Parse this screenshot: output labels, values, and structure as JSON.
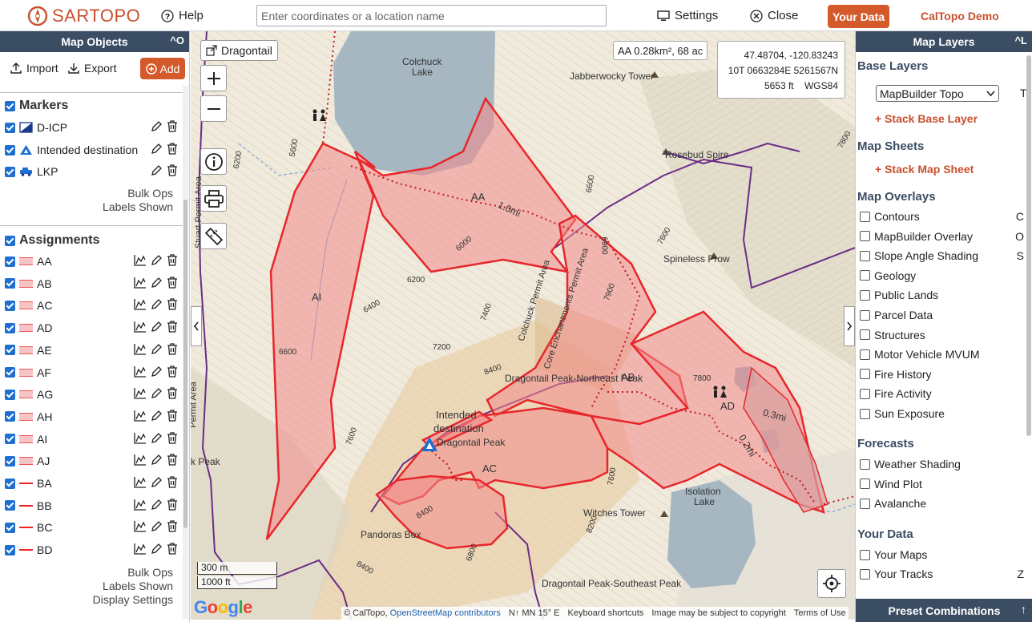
{
  "topbar": {
    "logo_a": "SAR",
    "logo_b": "TOPO",
    "help": "Help",
    "search_placeholder": "Enter coordinates or a location name",
    "settings": "Settings",
    "close": "Close",
    "your_data": "Your Data",
    "demo": "CalTopo Demo"
  },
  "left_panel": {
    "title": "Map Objects",
    "collapse_ctl": "^O",
    "import": "Import",
    "export": "Export",
    "add": "Add",
    "markers_title": "Markers",
    "markers": [
      {
        "label": "D-ICP"
      },
      {
        "label": "Intended destination"
      },
      {
        "label": "LKP"
      }
    ],
    "markers_bulk": "Bulk Ops",
    "markers_labels": "Labels Shown",
    "assignments_title": "Assignments",
    "assignments": [
      {
        "label": "AA",
        "kind": "area"
      },
      {
        "label": "AB",
        "kind": "area"
      },
      {
        "label": "AC",
        "kind": "area"
      },
      {
        "label": "AD",
        "kind": "area"
      },
      {
        "label": "AE",
        "kind": "area"
      },
      {
        "label": "AF",
        "kind": "area"
      },
      {
        "label": "AG",
        "kind": "area"
      },
      {
        "label": "AH",
        "kind": "area"
      },
      {
        "label": "AI",
        "kind": "area"
      },
      {
        "label": "AJ",
        "kind": "area"
      },
      {
        "label": "BA",
        "kind": "line"
      },
      {
        "label": "BB",
        "kind": "line"
      },
      {
        "label": "BC",
        "kind": "line"
      },
      {
        "label": "BD",
        "kind": "line"
      }
    ],
    "assign_bulk": "Bulk Ops",
    "assign_labels": "Labels Shown",
    "assign_display": "Display Settings"
  },
  "map": {
    "sheet_button": "Dragontail",
    "area_readout": "AA 0.28km², 68 ac",
    "coords": {
      "latlon": "47.48704, -120.83243",
      "utm": "10T 0663284E 5261567N",
      "elev": "5653 ft",
      "datum": "WGS84"
    },
    "scale_m": "300 m",
    "scale_ft": "1000 ft",
    "google": "Google",
    "attrib_caltopo": "© CalTopo,",
    "attrib_osm": "OpenStreetMap contributors",
    "attrib_mn": "N↑ MN 15° E",
    "attrib_keys": "Keyboard shortcuts",
    "attrib_copyright": "Image may be subject to copyright",
    "attrib_terms": "Terms of Use",
    "labels": {
      "colchuck": "Colchuck",
      "lake": "Lake",
      "jabberwocky": "Jabberwocky Tower",
      "rosebud": "Rosebud Spire",
      "spineless": "Spineless Prow",
      "dragon_north": "Dragontail Peak-Northeast Peak",
      "intended1": "Intended",
      "intended2": "destination",
      "dragon_peak": "Dragontail Peak",
      "isolation": "Isolation",
      "isolation2": "Lake",
      "witches": "Witches Tower",
      "pandoras": "Pandoras Box",
      "dragon_se": "Dragontail Peak-Southeast Peak",
      "peak": "k Peak",
      "colchuck_permit": "Colchuck Permit Area",
      "core_permit": "Core Enchantments Permit Area",
      "permit_left": "Permit Area",
      "permit_left2": "Stuart Permit Area",
      "aa": "AA",
      "ab": "AB",
      "ac": "AC",
      "ad": "AD",
      "ai": "AI",
      "d1": "1.0mi",
      "d2": "0.3mi",
      "d3": "0.2mi"
    },
    "contours": [
      "5600",
      "6200",
      "6000",
      "6200",
      "6400",
      "6600",
      "7400",
      "7200",
      "7600",
      "7800",
      "8400",
      "7600",
      "6600",
      "7600",
      "8400",
      "8200",
      "8400",
      "6800",
      "6900",
      "7900",
      "7800"
    ]
  },
  "right_panel": {
    "title": "Map Layers",
    "collapse_ctl": "^L",
    "base_layers": "Base Layers",
    "base_select": "MapBuilder Topo",
    "base_key": "T",
    "stack_base": "+ Stack Base Layer",
    "map_sheets": "Map Sheets",
    "stack_sheet": "+ Stack Map Sheet",
    "overlays_title": "Map Overlays",
    "overlays": [
      {
        "label": "Contours",
        "key": "C"
      },
      {
        "label": "MapBuilder Overlay",
        "key": "O"
      },
      {
        "label": "Slope Angle Shading",
        "key": "S"
      },
      {
        "label": "Geology",
        "key": ""
      },
      {
        "label": "Public Lands",
        "key": ""
      },
      {
        "label": "Parcel Data",
        "key": ""
      },
      {
        "label": "Structures",
        "key": ""
      },
      {
        "label": "Motor Vehicle MVUM",
        "key": ""
      },
      {
        "label": "Fire History",
        "key": ""
      },
      {
        "label": "Fire Activity",
        "key": ""
      },
      {
        "label": "Sun Exposure",
        "key": ""
      }
    ],
    "forecasts_title": "Forecasts",
    "forecasts": [
      {
        "label": "Weather Shading"
      },
      {
        "label": "Wind Plot"
      },
      {
        "label": "Avalanche"
      }
    ],
    "yourdata_title": "Your Data",
    "yourdata": [
      {
        "label": "Your Maps",
        "key": ""
      },
      {
        "label": "Your Tracks",
        "key": "Z"
      }
    ],
    "preset": "Preset Combinations",
    "preset_arrow": "↑"
  },
  "colors": {
    "brand": "#c8502e",
    "header": "#3b4d63",
    "checkbox": "#1f6fd1",
    "assignment_fill": "#f28a8a",
    "assignment_stroke": "#e8262c"
  }
}
